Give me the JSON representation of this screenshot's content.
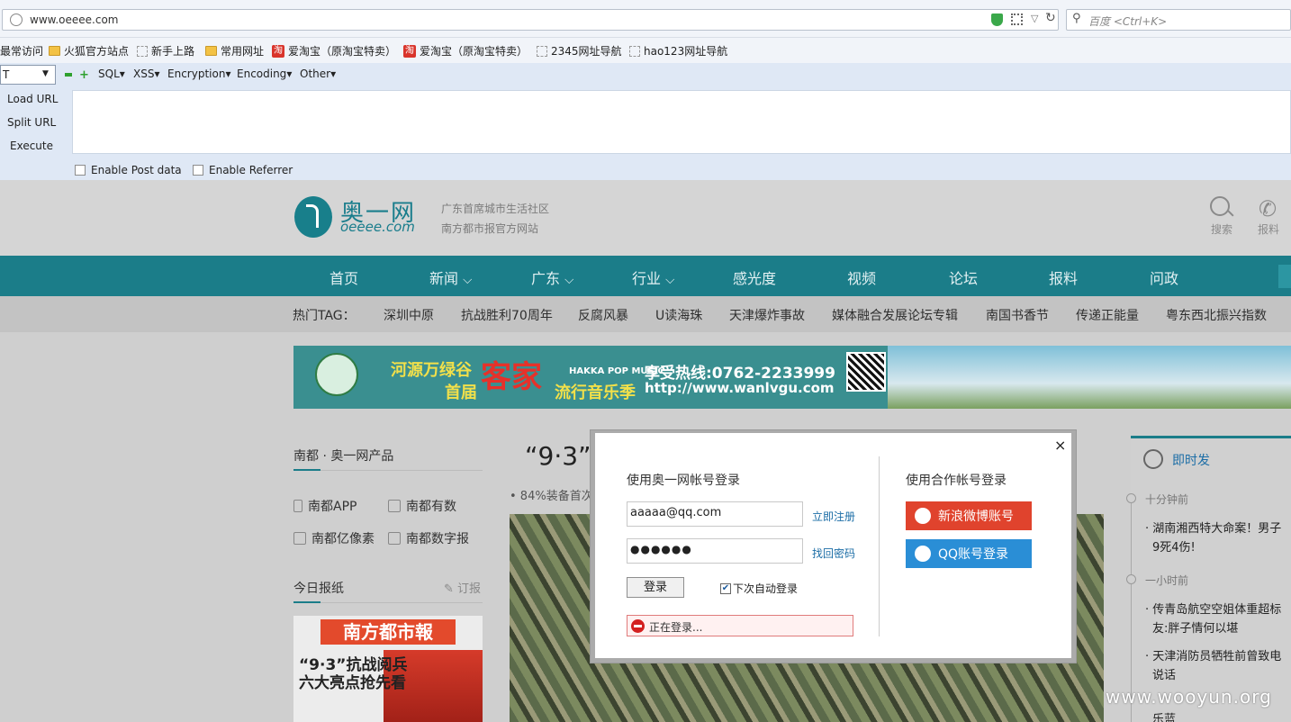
{
  "browser": {
    "url": "www.oeeee.com",
    "search_placeholder": "百度 <Ctrl+K>",
    "bookmarks": [
      "最常访问",
      "火狐官方站点",
      "新手上路",
      "常用网址",
      "爱淘宝（原淘宝特卖）",
      "爱淘宝（原淘宝特卖）",
      "2345网址导航",
      "hao123网址导航"
    ]
  },
  "hackbar": {
    "select_value": "T",
    "menus": [
      "SQL",
      "XSS",
      "Encryption",
      "Encoding",
      "Other"
    ],
    "actions": [
      "Load URL",
      "Split URL",
      "Execute"
    ],
    "checkboxes": [
      "Enable Post data",
      "Enable Referrer"
    ]
  },
  "site": {
    "logo_cn": "奥一网",
    "logo_en": "oeeee.com",
    "slogan1": "广东首席城市生活社区",
    "slogan2": "南方都市报官方网站",
    "search_label": "搜索",
    "report_label": "报料",
    "nav": [
      "首页",
      "新闻",
      "广东",
      "行业",
      "感光度",
      "视频",
      "论坛",
      "报料",
      "问政"
    ],
    "tag_label": "热门TAG：",
    "tags": [
      "深圳中原",
      "抗战胜利70周年",
      "反腐风暴",
      "U读海珠",
      "天津爆炸事故",
      "媒体融合发展论坛专辑",
      "南国书香节",
      "传递正能量",
      "粤东西北振兴指数"
    ],
    "banner": {
      "l1": "河源万绿谷",
      "l2": "客家",
      "l3": "首届",
      "l4": "流行音乐季",
      "l5": "HAKKA POP MUSIC",
      "l6": "享受热线:0762-2233999",
      "l7": "http://www.wanlvgu.com"
    },
    "left": {
      "products_title": "南都 · 奥一网产品",
      "products": [
        "南都APP",
        "南都有数",
        "南都亿像素",
        "南都数字报"
      ],
      "paper_title": "今日报纸",
      "subscribe": "订报",
      "paper_masthead": "南方都市報",
      "paper_head1": "“9·3”抗战阅兵",
      "paper_head2": "六大亮点抢先看"
    },
    "main": {
      "title": "“9·3”",
      "subtitle": "• 84%装备首次"
    },
    "right": {
      "title": "即时发",
      "t1": "十分钟前",
      "n1a": "湖南湘西特大命案！男子",
      "n1b": "9死4伤!",
      "t2": "一小时前",
      "n2a": "传青岛航空空姐体重超标",
      "n2b": "友:胖子情何以堪",
      "n3a": "天津消防员牺牲前曾致电",
      "n3b": "说话",
      "n4a": "乐蓝"
    },
    "watermark": "www.wooyun.org"
  },
  "modal": {
    "close": "×",
    "own_title": "使用奥一网帐号登录",
    "partner_title": "使用合作帐号登录",
    "email": "aaaaa@qq.com",
    "password": "●●●●●●",
    "register": "立即注册",
    "forgot": "找回密码",
    "login": "登录",
    "auto_login": "下次自动登录",
    "status": "正在登录...",
    "weibo": "新浪微博账号",
    "qq": "QQ账号登录",
    "weibo_color": "#e0432d",
    "qq_color": "#2a8ed6"
  }
}
